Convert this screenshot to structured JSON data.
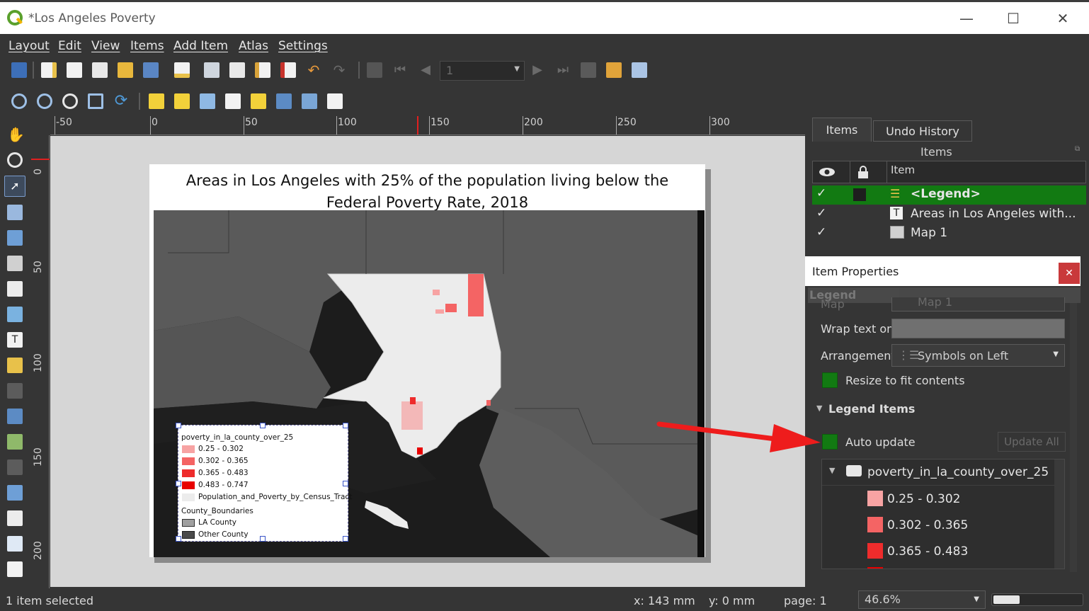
{
  "window": {
    "title": "*Los Angeles Poverty"
  },
  "menu": [
    "Layout",
    "Edit",
    "View",
    "Items",
    "Add Item",
    "Atlas",
    "Settings"
  ],
  "toolbar": {
    "page_number": "1"
  },
  "ruler": {
    "horizontal": [
      "-50",
      "0",
      "50",
      "100",
      "150",
      "200",
      "250",
      "300"
    ],
    "vertical": [
      "0",
      "50",
      "100",
      "150",
      "200"
    ]
  },
  "map": {
    "title_line1": "Areas in Los Angeles with 25% of the population living below the",
    "title_line2": "Federal Poverty Rate, 2018"
  },
  "legend": {
    "layer": "poverty_in_la_county_over_25",
    "classes": [
      {
        "label": "0.25 - 0.302",
        "color": "#f7a3a3"
      },
      {
        "label": "0.302 - 0.365",
        "color": "#f46464"
      },
      {
        "label": "0.365 - 0.483",
        "color": "#ee2c2c"
      },
      {
        "label": "0.483 - 0.747",
        "color": "#e80000"
      }
    ],
    "census_layer": "Population_and_Poverty_by_Census_Tract",
    "county_group": "County_Boundaries",
    "county_items": [
      {
        "label": "LA County",
        "color": "#a0a0a0"
      },
      {
        "label": "Other County",
        "color": "#4a4a4a"
      }
    ]
  },
  "panel": {
    "tabs": [
      "Items",
      "Undo History"
    ],
    "items_title": "Items",
    "column_item": "Item",
    "items": [
      {
        "label": "<Legend>",
        "visible": "✓",
        "selected": true
      },
      {
        "label": "Areas in Los Angeles with...",
        "visible": "✓",
        "selected": false
      },
      {
        "label": "Map 1",
        "visible": "✓",
        "selected": false
      }
    ]
  },
  "properties": {
    "title": "Item Properties",
    "section": "Legend",
    "map_label": "Map",
    "map_value": "Map 1",
    "wrap_label": "Wrap text on",
    "arrangement_label": "Arrangement",
    "arrangement_value": "Symbols on Left",
    "resize_label": "Resize to fit contents",
    "legend_items_heading": "Legend Items",
    "auto_update_label": "Auto update",
    "update_all_label": "Update All",
    "tree_layer": "poverty_in_la_county_over_25",
    "tree_classes": [
      "0.25 - 0.302",
      "0.302 - 0.365",
      "0.365 - 0.483"
    ]
  },
  "status": {
    "selection": "1 item selected",
    "x": "x: 143 mm",
    "y": "y: 0 mm",
    "page": "page: 1",
    "zoom": "46.6%",
    "zoom_fraction": 0.3
  },
  "colors": {
    "accent_green": "#127a12",
    "annotation_arrow": "#ee1c1c"
  }
}
